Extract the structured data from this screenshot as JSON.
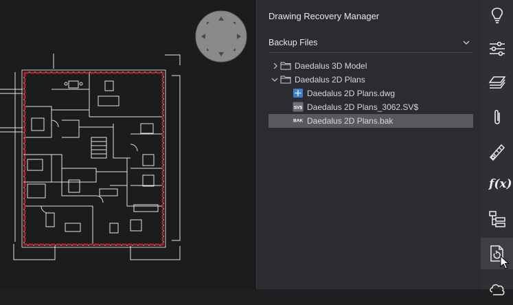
{
  "panel": {
    "title": "Drawing Recovery Manager",
    "section_title": "Backup Files"
  },
  "tree": [
    {
      "label": "Daedalus 3D Model",
      "type": "folder",
      "expanded": false
    },
    {
      "label": "Daedalus 2D Plans",
      "type": "folder",
      "expanded": true
    },
    {
      "label": "Daedalus 2D Plans.dwg",
      "type": "dwg-file",
      "icon_text": ""
    },
    {
      "label": "Daedalus 2D Plans_3062.SV$",
      "type": "sv-file",
      "icon_text": "SV$"
    },
    {
      "label": "Daedalus 2D Plans.bak",
      "type": "bak-file",
      "icon_text": "BAK",
      "selected": true
    }
  ],
  "rail": {
    "items": [
      "lightbulb-icon",
      "properties-sliders-icon",
      "layers-icon",
      "paperclip-icon",
      "ruler-icon",
      "fx-icon",
      "hierarchy-icon",
      "drawing-recovery-icon",
      "cloud-icon"
    ],
    "fx_label": "f(x)",
    "active": "drawing-recovery-icon"
  },
  "colors": {
    "canvas_bg": "#1b1c1d",
    "panel_bg": "#2b2c30",
    "rail_bg": "#2f3034",
    "selected_row": "#585a5f",
    "wall_red": "#b0232a",
    "drawing_line": "#e8e8e8"
  }
}
